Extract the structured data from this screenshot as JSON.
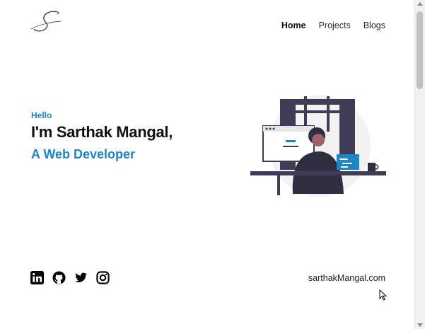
{
  "nav": {
    "items": [
      {
        "label": "Home",
        "active": true
      },
      {
        "label": "Projects",
        "active": false
      },
      {
        "label": "Blogs",
        "active": false
      }
    ]
  },
  "hero": {
    "greeting": "Hello",
    "name": "I'm Sarthak Mangal,",
    "role": "A Web Developer"
  },
  "footer": {
    "socials": [
      "linkedin-icon",
      "github-icon",
      "twitter-icon",
      "instagram-icon"
    ],
    "site_label": "sarthakMangal.com"
  },
  "colors": {
    "accent": "#1e85c4",
    "text": "#111111",
    "illustration_dark": "#3f3d56",
    "illustration_light": "#f2f2f2"
  }
}
